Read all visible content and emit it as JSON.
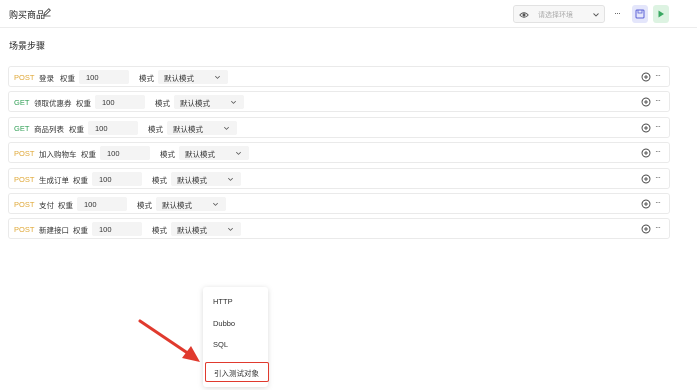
{
  "header": {
    "title": "购买商品",
    "env_placeholder": "请选择环境"
  },
  "section_title": "场景步骤",
  "steps": [
    {
      "method": "POST",
      "name": "登录",
      "weight_label": "权重",
      "weight": "100",
      "mode_label": "模式",
      "mode": "默认模式"
    },
    {
      "method": "GET",
      "name": "领取优惠券",
      "weight_label": "权重",
      "weight": "100",
      "mode_label": "模式",
      "mode": "默认模式"
    },
    {
      "method": "GET",
      "name": "商品列表",
      "weight_label": "权重",
      "weight": "100",
      "mode_label": "模式",
      "mode": "默认模式"
    },
    {
      "method": "POST",
      "name": "加入购物车",
      "weight_label": "权重",
      "weight": "100",
      "mode_label": "模式",
      "mode": "默认模式"
    },
    {
      "method": "POST",
      "name": "生成订单",
      "weight_label": "权重",
      "weight": "100",
      "mode_label": "模式",
      "mode": "默认模式"
    },
    {
      "method": "POST",
      "name": "支付",
      "weight_label": "权重",
      "weight": "100",
      "mode_label": "模式",
      "mode": "默认模式"
    },
    {
      "method": "POST",
      "name": "新建接口",
      "weight_label": "权重",
      "weight": "100",
      "mode_label": "模式",
      "mode": "默认模式"
    }
  ],
  "add_menu": {
    "items": [
      "HTTP",
      "Dubbo",
      "SQL",
      "引入测试对象"
    ]
  },
  "colors": {
    "post": "#e0a93a",
    "get": "#36a25a",
    "highlight": "#e03a2e"
  },
  "icons": {
    "edit": "pencil-icon",
    "env": "eye-icon",
    "save": "save-icon",
    "run": "play-icon",
    "add": "plus-circle-icon",
    "more": "more-icon"
  }
}
